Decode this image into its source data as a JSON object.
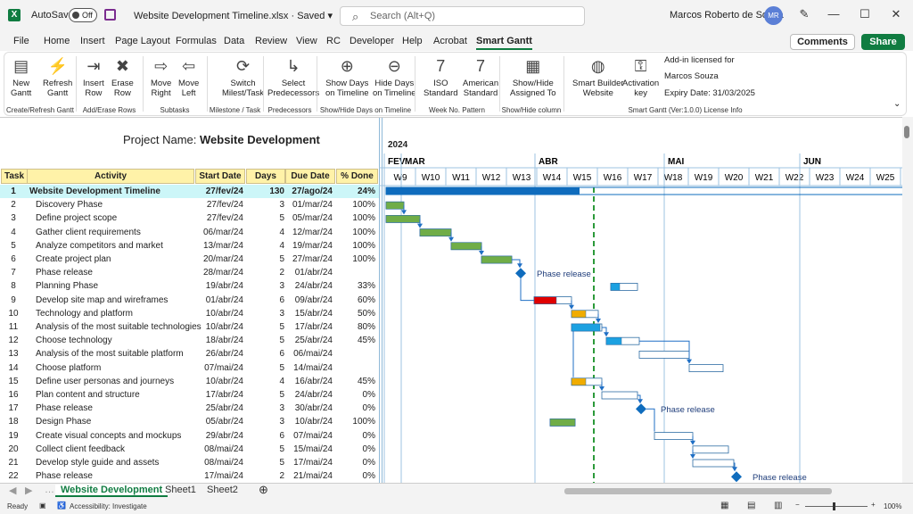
{
  "title_bar": {
    "app_logo": "X",
    "autosave_label": "AutoSave",
    "autosave_state": "Off",
    "file_name": "Website Development Timeline.xlsx · Saved ▾",
    "search_placeholder": "Search (Alt+Q)",
    "user_name": "Marcos Roberto de Souza",
    "user_initials": "MR"
  },
  "menu": {
    "items": [
      "File",
      "Home",
      "Insert",
      "Page Layout",
      "Formulas",
      "Data",
      "Review",
      "View",
      "RC",
      "Developer",
      "Help",
      "Acrobat",
      "Smart Gantt"
    ],
    "active": "Smart Gantt",
    "comments_label": "Comments",
    "share_label": "Share"
  },
  "ribbon": {
    "buttons": [
      {
        "l1": "New",
        "l2": "Gantt",
        "icon": "new-gantt-icon"
      },
      {
        "l1": "Refresh",
        "l2": "Gantt",
        "icon": "refresh-gantt-icon"
      },
      {
        "l1": "Insert",
        "l2": "Row",
        "icon": "insert-row-icon"
      },
      {
        "l1": "Erase",
        "l2": "Row",
        "icon": "erase-row-icon"
      },
      {
        "l1": "Move",
        "l2": "Right",
        "icon": "arrow-right-icon"
      },
      {
        "l1": "Move",
        "l2": "Left",
        "icon": "arrow-left-icon"
      },
      {
        "l1": "Switch",
        "l2": "Milest/Task",
        "icon": "switch-icon"
      },
      {
        "l1": "Select",
        "l2": "Predecessors",
        "icon": "select-predecessors-icon"
      },
      {
        "l1": "Show Days",
        "l2": "on Timeline",
        "icon": "zoom-in-icon"
      },
      {
        "l1": "Hide Days",
        "l2": "on Timeline",
        "icon": "zoom-out-icon"
      },
      {
        "l1": "ISO",
        "l2": "Standard",
        "icon": "calendar-iso-icon"
      },
      {
        "l1": "American",
        "l2": "Standard",
        "icon": "calendar-american-icon"
      },
      {
        "l1": "Show/Hide",
        "l2": "Assigned To",
        "icon": "table-columns-icon"
      },
      {
        "l1": "Smart Builder",
        "l2": "Website",
        "icon": "globe-icon"
      },
      {
        "l1": "Activation",
        "l2": "key",
        "icon": "key-icon"
      }
    ],
    "groups": [
      "Create/Refresh Gantt",
      "Add/Erase Rows",
      "Subtasks",
      "Milestone / Task",
      "Predecessors",
      "Show/Hide Days on Timeline",
      "Week No. Pattern",
      "Show/Hide column",
      "Smart Gantt (Ver:1.0.0) License Info"
    ],
    "license": {
      "line1": "Add-in licensed for",
      "line2": "Marcos Souza",
      "line3": "Expiry Date: 31/03/2025"
    }
  },
  "sheet": {
    "project_label": "Project Name:",
    "project_name": "Website Development",
    "headers": [
      "Task",
      "Activity",
      "Start Date",
      "Days",
      "Due Date",
      "% Done"
    ],
    "rows": [
      [
        "1",
        "Website Development Timeline",
        "27/fev/24",
        "130",
        "27/ago/24",
        "24%"
      ],
      [
        "2",
        "Discovery Phase",
        "27/fev/24",
        "3",
        "01/mar/24",
        "100%"
      ],
      [
        "3",
        "Define project scope",
        "27/fev/24",
        "5",
        "05/mar/24",
        "100%"
      ],
      [
        "4",
        "Gather client requirements",
        "06/mar/24",
        "4",
        "12/mar/24",
        "100%"
      ],
      [
        "5",
        "Analyze competitors and market",
        "13/mar/24",
        "4",
        "19/mar/24",
        "100%"
      ],
      [
        "6",
        "Create project plan",
        "20/mar/24",
        "5",
        "27/mar/24",
        "100%"
      ],
      [
        "7",
        "Phase release",
        "28/mar/24",
        "2",
        "01/abr/24",
        ""
      ],
      [
        "8",
        "Planning Phase",
        "19/abr/24",
        "3",
        "24/abr/24",
        "33%"
      ],
      [
        "9",
        "Develop site map and wireframes",
        "01/abr/24",
        "6",
        "09/abr/24",
        "60%"
      ],
      [
        "10",
        "Technology and platform",
        "10/abr/24",
        "3",
        "15/abr/24",
        "50%"
      ],
      [
        "11",
        "Analysis of the most suitable technologies",
        "10/abr/24",
        "5",
        "17/abr/24",
        "80%"
      ],
      [
        "12",
        "Choose technology",
        "18/abr/24",
        "5",
        "25/abr/24",
        "45%"
      ],
      [
        "13",
        "Analysis of the most suitable platform",
        "26/abr/24",
        "6",
        "06/mai/24",
        ""
      ],
      [
        "14",
        "Choose platform",
        "07/mai/24",
        "5",
        "14/mai/24",
        ""
      ],
      [
        "15",
        "Define user personas and journeys",
        "10/abr/24",
        "4",
        "16/abr/24",
        "45%"
      ],
      [
        "16",
        "Plan content and structure",
        "17/abr/24",
        "5",
        "24/abr/24",
        "0%"
      ],
      [
        "17",
        "Phase release",
        "25/abr/24",
        "3",
        "30/abr/24",
        "0%"
      ],
      [
        "18",
        "Design Phase",
        "05/abr/24",
        "3",
        "10/abr/24",
        "100%"
      ],
      [
        "19",
        "Create visual concepts and mockups",
        "29/abr/24",
        "6",
        "07/mai/24",
        "0%"
      ],
      [
        "20",
        "Collect client feedback",
        "08/mai/24",
        "5",
        "15/mai/24",
        "0%"
      ],
      [
        "21",
        "Develop style guide and assets",
        "08/mai/24",
        "5",
        "17/mai/24",
        "0%"
      ],
      [
        "22",
        "Phase release",
        "17/mai/24",
        "2",
        "21/mai/24",
        "0%"
      ]
    ]
  },
  "timeline": {
    "year": "2024",
    "months": [
      "FEV",
      "MAR",
      "ABR",
      "MAI",
      "JUN"
    ],
    "weeks": [
      "W9",
      "W10",
      "W11",
      "W12",
      "W13",
      "W14",
      "W15",
      "W16",
      "W17",
      "W18",
      "W19",
      "W20",
      "W21",
      "W22",
      "W23",
      "W24",
      "W25"
    ],
    "milestone_label": "Phase release",
    "colors": {
      "done": "#70ad47",
      "progress": "#1ca1e1",
      "summary": "#0f6cbd",
      "late": "#e00000",
      "warn": "#f0ac00",
      "milestone": "#0f6cbd",
      "today": "#2c9a3a"
    }
  },
  "tabs": {
    "sheets": [
      "Website Development",
      "Sheet1",
      "Sheet2"
    ],
    "active": "Website Development"
  },
  "status": {
    "ready": "Ready",
    "accessibility": "Accessibility: Investigate",
    "zoom": "100%"
  }
}
